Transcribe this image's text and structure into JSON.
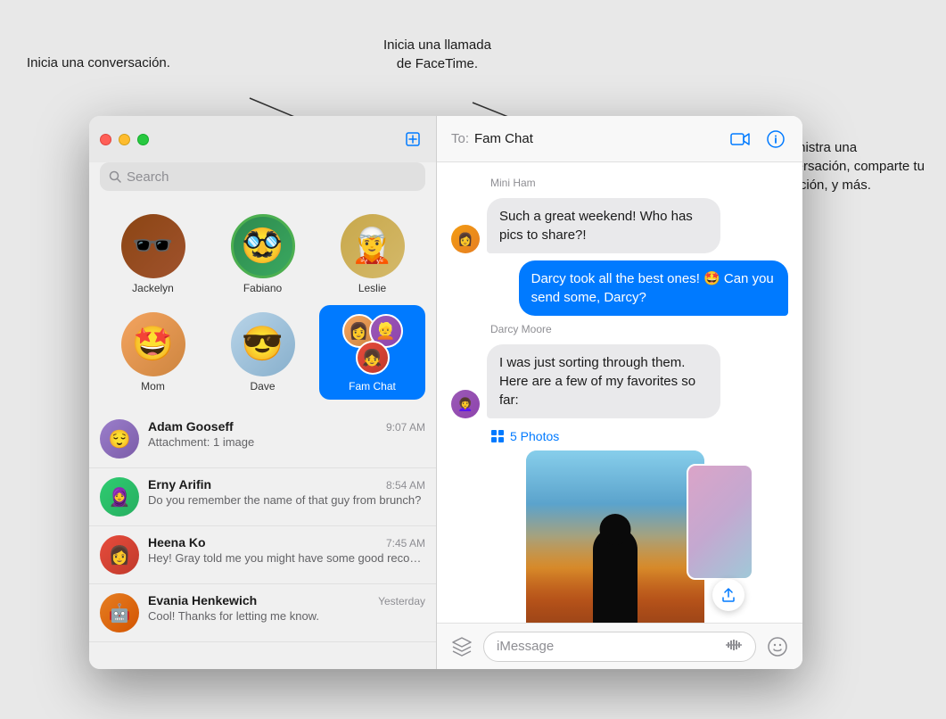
{
  "annotations": {
    "new_conversation": "Inicia una conversación.",
    "facetime_call": "Inicia una llamada\nde FaceTime.",
    "manage_conversation": "Administra una conversación, comparte tu ubicación, y más."
  },
  "sidebar": {
    "search_placeholder": "Search",
    "compose_label": "Compose",
    "pinned": [
      {
        "id": "jackelyn",
        "name": "Jackelyn",
        "emoji": "🕶️"
      },
      {
        "id": "fabiano",
        "name": "Fabiano",
        "emoji": "🥸"
      },
      {
        "id": "leslie",
        "name": "Leslie",
        "emoji": "🧝"
      },
      {
        "id": "mom",
        "name": "Mom",
        "emoji": "🤩"
      },
      {
        "id": "dave",
        "name": "Dave",
        "emoji": "😎"
      },
      {
        "id": "famchat",
        "name": "Fam Chat",
        "emoji": "👨‍👩‍👧",
        "active": true
      }
    ],
    "conversations": [
      {
        "id": "adam",
        "name": "Adam Gooseff",
        "preview": "Attachment: 1 image",
        "time": "9:07 AM",
        "emoji": "😌"
      },
      {
        "id": "erny",
        "name": "Erny Arifin",
        "preview": "Do you remember the name of that guy from brunch?",
        "time": "8:54 AM",
        "emoji": "🧕"
      },
      {
        "id": "heena",
        "name": "Heena Ko",
        "preview": "Hey! Gray told me you might have some good recommendations for our...",
        "time": "7:45 AM",
        "emoji": "👩"
      },
      {
        "id": "evania",
        "name": "Evania Henkewich",
        "preview": "Cool! Thanks for letting me know.",
        "time": "Yesterday",
        "emoji": "🤖"
      }
    ]
  },
  "chat": {
    "to_label": "To:",
    "conversation_name": "Fam Chat",
    "facetime_btn": "FaceTime",
    "info_btn": "Info",
    "messages": [
      {
        "id": "msg1",
        "type": "incoming",
        "sender": "Mini Ham",
        "text": "Such a great weekend! Who has pics to share?!",
        "show_avatar": false
      },
      {
        "id": "msg2",
        "type": "outgoing",
        "text": "Darcy took all the best ones! 🤩 Can you send some, Darcy?"
      },
      {
        "id": "msg3",
        "type": "incoming",
        "sender": "Darcy Moore",
        "text": "I was just sorting through them. Here are a few of my favorites so far:"
      },
      {
        "id": "msg4",
        "type": "photos",
        "photos_label": "5 Photos"
      }
    ],
    "input_placeholder": "iMessage",
    "apps_btn": "Apps"
  },
  "colors": {
    "blue": "#007aff",
    "bubble_incoming": "#e9e9eb",
    "bubble_outgoing": "#007aff",
    "sidebar_bg": "#f0f0f0",
    "chat_bg": "#ffffff"
  }
}
